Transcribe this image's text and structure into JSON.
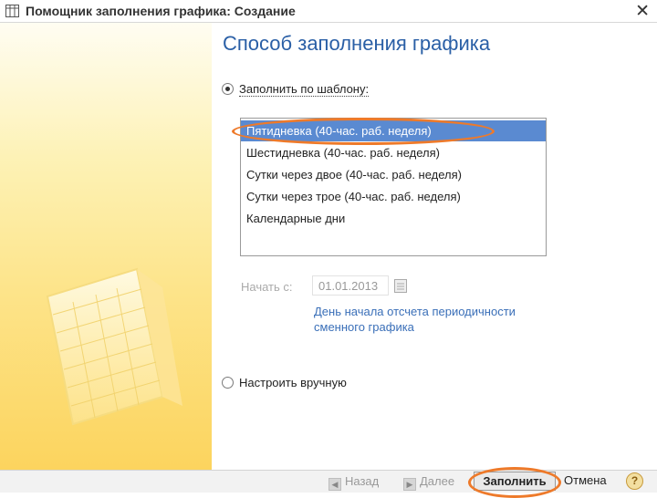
{
  "window": {
    "title": "Помощник заполнения графика: Создание",
    "close_glyph": "✕",
    "icon": "calendar-grid-icon"
  },
  "main": {
    "heading": "Способ заполнения графика",
    "option_template": {
      "label": "Заполнить по шаблону:",
      "selected": true
    },
    "templates": [
      {
        "label": "Пятидневка (40-час. раб. неделя)",
        "selected": true
      },
      {
        "label": "Шестидневка (40-час. раб. неделя)",
        "selected": false
      },
      {
        "label": "Сутки через двое (40-час. раб. неделя)",
        "selected": false
      },
      {
        "label": "Сутки через трое (40-час. раб. неделя)",
        "selected": false
      },
      {
        "label": "Календарные дни",
        "selected": false
      }
    ],
    "start_label": "Начать с:",
    "start_date": "01.01.2013",
    "hint": "День начала отсчета периодичности сменного графика",
    "option_manual": {
      "label": "Настроить вручную",
      "selected": false
    }
  },
  "footer": {
    "back_label": "Назад",
    "next_label": "Далее",
    "fill_label": "Заполнить",
    "cancel_label": "Отмена",
    "help_label": "?"
  },
  "colors": {
    "accent": "#2a5fa6",
    "selection": "#5a8ad1",
    "highlight_ring": "#ee7a2a",
    "side_panel": "#fde48a"
  }
}
